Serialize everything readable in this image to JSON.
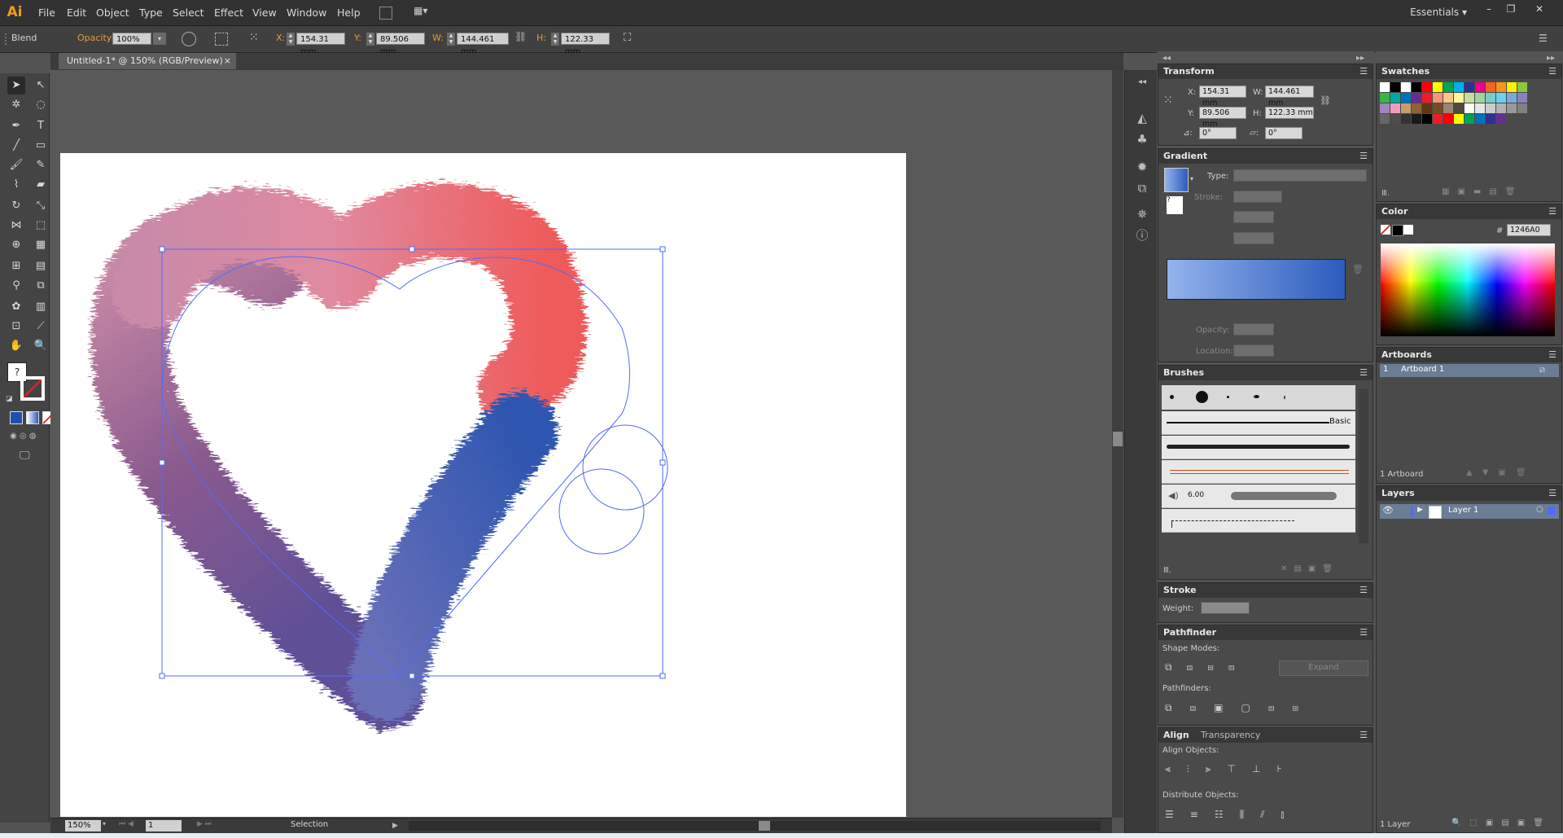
{
  "app": {
    "logo": "Ai",
    "workspace": "Essentials",
    "window_controls": [
      "–",
      "❐",
      "✕"
    ]
  },
  "menu": [
    "File",
    "Edit",
    "Object",
    "Type",
    "Select",
    "Effect",
    "View",
    "Window",
    "Help"
  ],
  "control": {
    "object_type": "Blend",
    "opacity_label": "Opacity:",
    "opacity": "100%",
    "x_label": "X:",
    "x": "154.31 mm",
    "y_label": "Y:",
    "y": "89.506 mm",
    "w_label": "W:",
    "w": "144.461 mm",
    "h_label": "H:",
    "h": "122.33 mm"
  },
  "document": {
    "tab_title": "Untitled-1* @ 150% (RGB/Preview)",
    "close": "×"
  },
  "status": {
    "zoom": "150%",
    "artboard_number": "1",
    "tool": "Selection"
  },
  "transform": {
    "title": "Transform",
    "x_label": "X:",
    "x": "154.31 mm",
    "y_label": "Y:",
    "y": "89.506 mm",
    "w_label": "W:",
    "w": "144.461 mm",
    "h_label": "H:",
    "h": "122.33 mm",
    "rotate": "0°",
    "shear": "0°"
  },
  "gradient": {
    "title": "Gradient",
    "type_label": "Type:",
    "stroke_label": "Stroke:",
    "opacity_label": "Opacity:",
    "location_label": "Location:",
    "stops": [
      "#93b3ec",
      "#2b5bbd"
    ]
  },
  "brushes": {
    "title": "Brushes",
    "basic_label": "Basic",
    "size_value": "6.00"
  },
  "stroke": {
    "title": "Stroke",
    "weight_label": "Weight:"
  },
  "pathfinder": {
    "title": "Pathfinder",
    "shape_modes": "Shape Modes:",
    "expand": "Expand",
    "pathfinders": "Pathfinders:"
  },
  "align": {
    "title": "Align",
    "tab2": "Transparency",
    "align_objects": "Align Objects:",
    "distribute_objects": "Distribute Objects:"
  },
  "swatches": {
    "title": "Swatches",
    "colors": [
      "#ffffff",
      "#000000",
      "#ffffff",
      "#000000",
      "#ff0000",
      "#ffff00",
      "#00a651",
      "#00aeef",
      "#2e3192",
      "#ec008c",
      "#f26522",
      "#f7941d",
      "#fff200",
      "#8dc63f",
      "#39b54a",
      "#00a99d",
      "#0072bc",
      "#662d91",
      "#ed1c24",
      "#f69679",
      "#fdc689",
      "#fff799",
      "#c4df9b",
      "#a3d39c",
      "#7accc8",
      "#6dcff6",
      "#7da7d9",
      "#8781bd",
      "#a186be",
      "#f49ac1",
      "#c69c6d",
      "#8c6239",
      "#603913",
      "#754c24",
      "#998675",
      "#534741",
      "#ffffff",
      "#e6e6e6",
      "#cccccc",
      "#b3b3b3",
      "#999999",
      "#808080",
      "#666666",
      "#4d4d4d",
      "#333333",
      "#1a1a1a",
      "#000000",
      "#ed1c24",
      "#ff0000",
      "#ffff00",
      "#00a651",
      "#0072bc",
      "#2e3192",
      "#662d91"
    ]
  },
  "color": {
    "title": "Color",
    "hex_label": "#",
    "hex": "1246A0"
  },
  "artboards": {
    "title": "Artboards",
    "rows": [
      {
        "num": "1",
        "name": "Artboard 1"
      }
    ],
    "footer": "1 Artboard"
  },
  "layers": {
    "title": "Layers",
    "rows": [
      {
        "name": "Layer 1"
      }
    ],
    "footer": "1 Layer"
  },
  "colors": {
    "accent": "#f29b1d",
    "heart_top_left": "#c98aa8",
    "heart_top_right": "#ef5a5a",
    "heart_bottom_left": "#5e4f97",
    "heart_bottom_right": "#2e56b0",
    "selection": "#4f6bff"
  }
}
